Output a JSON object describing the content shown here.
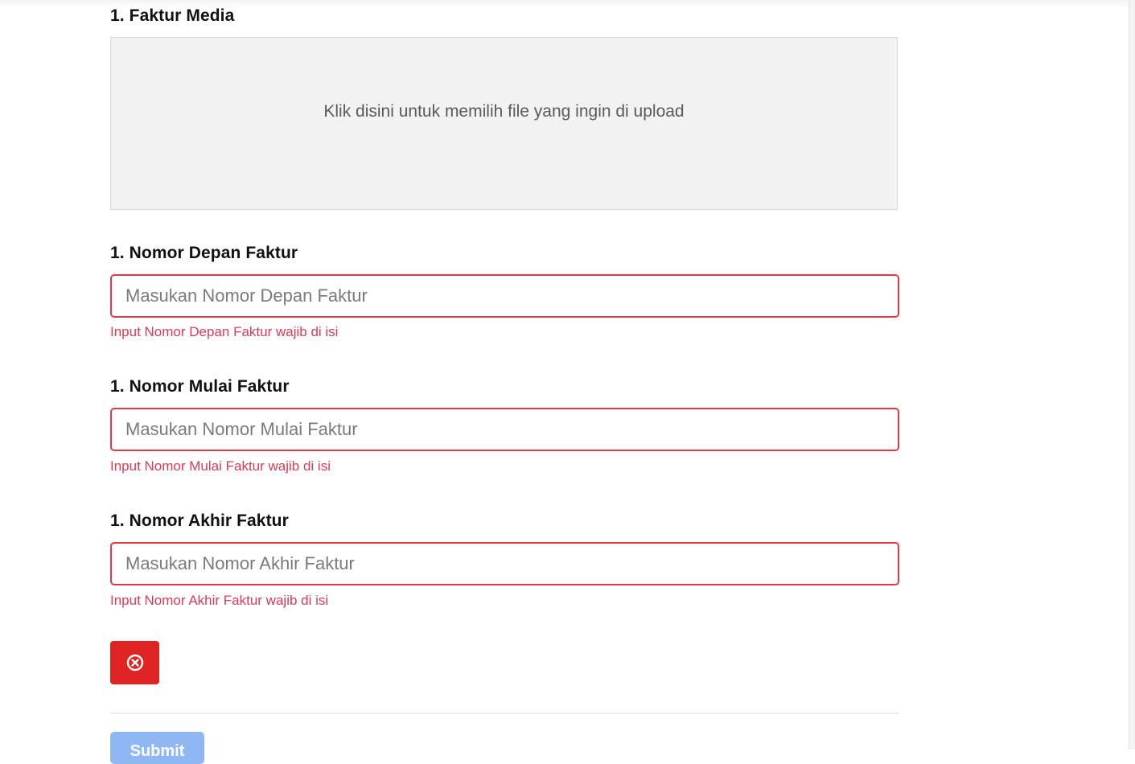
{
  "faktur_media": {
    "label": "1. Faktur Media",
    "dropzone_text": "Klik disini untuk memilih file yang ingin di upload"
  },
  "nomor_depan": {
    "label": "1. Nomor Depan Faktur",
    "placeholder": "Masukan Nomor Depan Faktur",
    "value": "",
    "error": "Input Nomor Depan Faktur wajib di isi"
  },
  "nomor_mulai": {
    "label": "1. Nomor Mulai Faktur",
    "placeholder": "Masukan Nomor Mulai Faktur",
    "value": "",
    "error": "Input Nomor Mulai Faktur wajib di isi"
  },
  "nomor_akhir": {
    "label": "1. Nomor Akhir Faktur",
    "placeholder": "Masukan Nomor Akhir Faktur",
    "value": "",
    "error": "Input Nomor Akhir Faktur wajib di isi"
  },
  "remove_button": {
    "icon": "circle-x-icon"
  },
  "submit_button": {
    "label": "Submit"
  },
  "colors": {
    "error": "#e23a42",
    "remove_button": "#e02424",
    "submit_button": "#8fb7f3",
    "dropzone_bg": "#f2f2f2"
  }
}
